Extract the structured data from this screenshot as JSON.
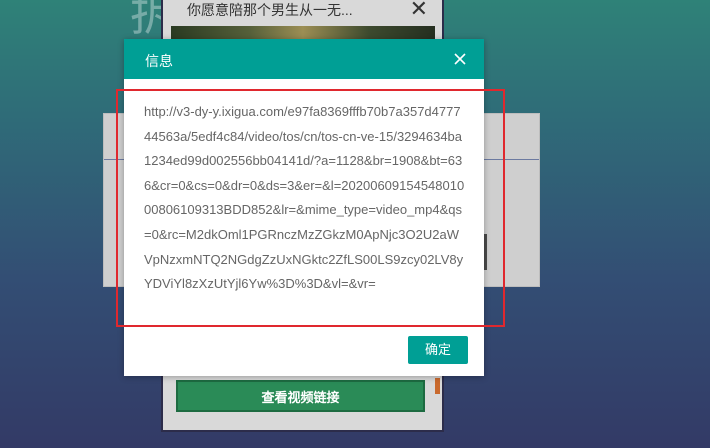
{
  "background": {
    "card_title": "你愿意陪那个男生从一无...",
    "link_button_label": "查看视频链接"
  },
  "dialog": {
    "title": "信息",
    "content": "http://v3-dy-y.ixigua.com/e97fa8369fffb70b7a357d477744563a/5edf4c84/video/tos/cn/tos-cn-ve-15/3294634ba1234ed99d002556bb04141d/?a=1128&br=1908&bt=636&cr=0&cs=0&dr=0&ds=3&er=&l=2020060915454801000806109313BDD852&lr=&mime_type=video_mp4&qs=0&rc=M2dkOml1PGRnczMzZGkzM0ApNjc3O2U2aWVpNzxmNTQ2NGdgZzUxNGktc2ZfLS00LS9zcy02LV8yYDViYl8zXzUtYjl6Yw%3D%3D&vl=&vr=",
    "ok_label": "确定"
  },
  "colors": {
    "accent": "#009f95",
    "highlight": "#e0282e",
    "link_button": "#2a8b57"
  }
}
